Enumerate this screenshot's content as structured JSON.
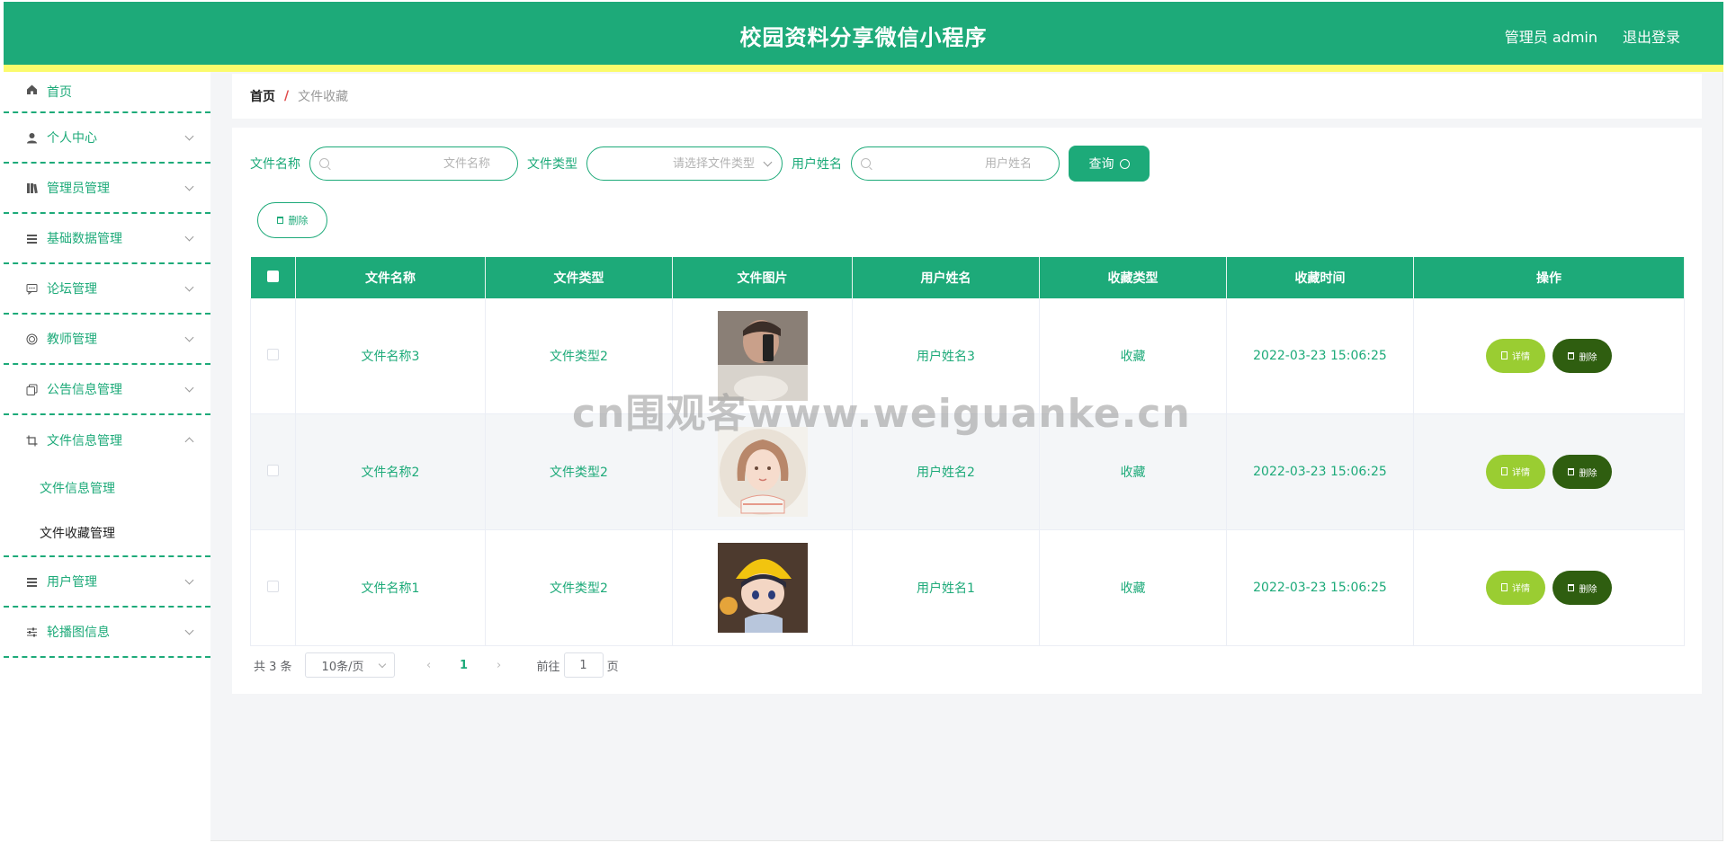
{
  "header": {
    "title": "校园资料分享微信小程序",
    "admin": "管理员 admin",
    "logout": "退出登录"
  },
  "sidebar": {
    "items": [
      {
        "label": "首页",
        "icon": "home-icon"
      },
      {
        "label": "个人中心",
        "icon": "user-icon"
      },
      {
        "label": "管理员管理",
        "icon": "books-icon"
      },
      {
        "label": "基础数据管理",
        "icon": "list-icon"
      },
      {
        "label": "论坛管理",
        "icon": "chat-icon"
      },
      {
        "label": "教师管理",
        "icon": "target-icon"
      },
      {
        "label": "公告信息管理",
        "icon": "copy-icon"
      },
      {
        "label": "文件信息管理",
        "icon": "crop-icon"
      },
      {
        "label": "用户管理",
        "icon": "list-icon"
      },
      {
        "label": "轮播图信息",
        "icon": "sliders-icon"
      }
    ],
    "sub_items": [
      "文件信息管理",
      "文件收藏管理"
    ]
  },
  "breadcrumb": {
    "home": "首页",
    "sep": "/",
    "current": "文件收藏"
  },
  "search": {
    "file_name_label": "文件名称",
    "file_name_placeholder": "文件名称",
    "file_type_label": "文件类型",
    "file_type_placeholder": "请选择文件类型",
    "user_name_label": "用户姓名",
    "user_name_placeholder": "用户姓名",
    "query_button": "查询"
  },
  "toolbar": {
    "delete_button": "删除"
  },
  "table": {
    "headers": [
      "文件名称",
      "文件类型",
      "文件图片",
      "用户姓名",
      "收藏类型",
      "收藏时间",
      "操作"
    ],
    "rows": [
      {
        "file_name": "文件名称3",
        "file_type": "文件类型2",
        "user_name": "用户姓名3",
        "fav_type": "收藏",
        "time": "2022-03-23 15:06:25"
      },
      {
        "file_name": "文件名称2",
        "file_type": "文件类型2",
        "user_name": "用户姓名2",
        "fav_type": "收藏",
        "time": "2022-03-23 15:06:25"
      },
      {
        "file_name": "文件名称1",
        "file_type": "文件类型2",
        "user_name": "用户姓名1",
        "fav_type": "收藏",
        "time": "2022-03-23 15:06:25"
      }
    ],
    "detail_button": "详情",
    "delete_button": "删除"
  },
  "pagination": {
    "total": "共 3 条",
    "page_size": "10条/页",
    "current_page": "1",
    "goto_label": "前往",
    "goto_value": "1",
    "page_suffix": "页"
  },
  "watermark": "cn围观客www.weiguanke.cn",
  "colors": {
    "primary": "#1daa79",
    "accent_line": "#fbfb6c",
    "detail_btn": "#9acd32",
    "delete_btn": "#2f5e10"
  }
}
